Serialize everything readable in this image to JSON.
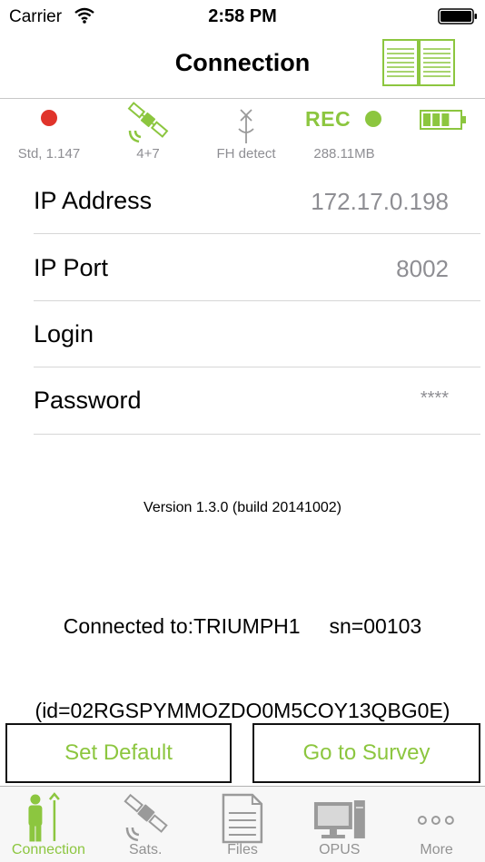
{
  "status_bar": {
    "carrier": "Carrier",
    "time": "2:58 PM"
  },
  "nav": {
    "title": "Connection",
    "manual_icon": "book-icon"
  },
  "indicators": {
    "position_status": "Std, 1.147",
    "satellites": "4+7",
    "radio": "FH detect",
    "rec_label": "REC",
    "memory": "288.11MB",
    "battery_level_fraction": 0.75
  },
  "form": {
    "ip_address": {
      "label": "IP Address",
      "value": "172.17.0.198"
    },
    "ip_port": {
      "label": "IP Port",
      "value": "8002"
    },
    "login": {
      "label": "Login",
      "value": ""
    },
    "password": {
      "label": "Password",
      "value": "****"
    }
  },
  "version": "Version 1.3.0 (build 20141002)",
  "connection_info": {
    "line1": "Connected to:TRIUMPH1     sn=00103",
    "line2": "(id=02RGSPYMMOZDO0M5COY13QBG0E)"
  },
  "buttons": {
    "set_default": "Set Default",
    "go_to_survey": "Go to Survey"
  },
  "tabs": [
    {
      "label": "Connection",
      "icon": "surveyor-icon",
      "active": true
    },
    {
      "label": "Sats.",
      "icon": "satellite-icon",
      "active": false
    },
    {
      "label": "Files",
      "icon": "file-icon",
      "active": false
    },
    {
      "label": "OPUS",
      "icon": "computer-icon",
      "active": false
    },
    {
      "label": "More",
      "icon": "more-icon",
      "active": false
    }
  ],
  "colors": {
    "accent": "#8cc63f",
    "record_red": "#e0342b",
    "secondary_text": "#8e8e93"
  }
}
